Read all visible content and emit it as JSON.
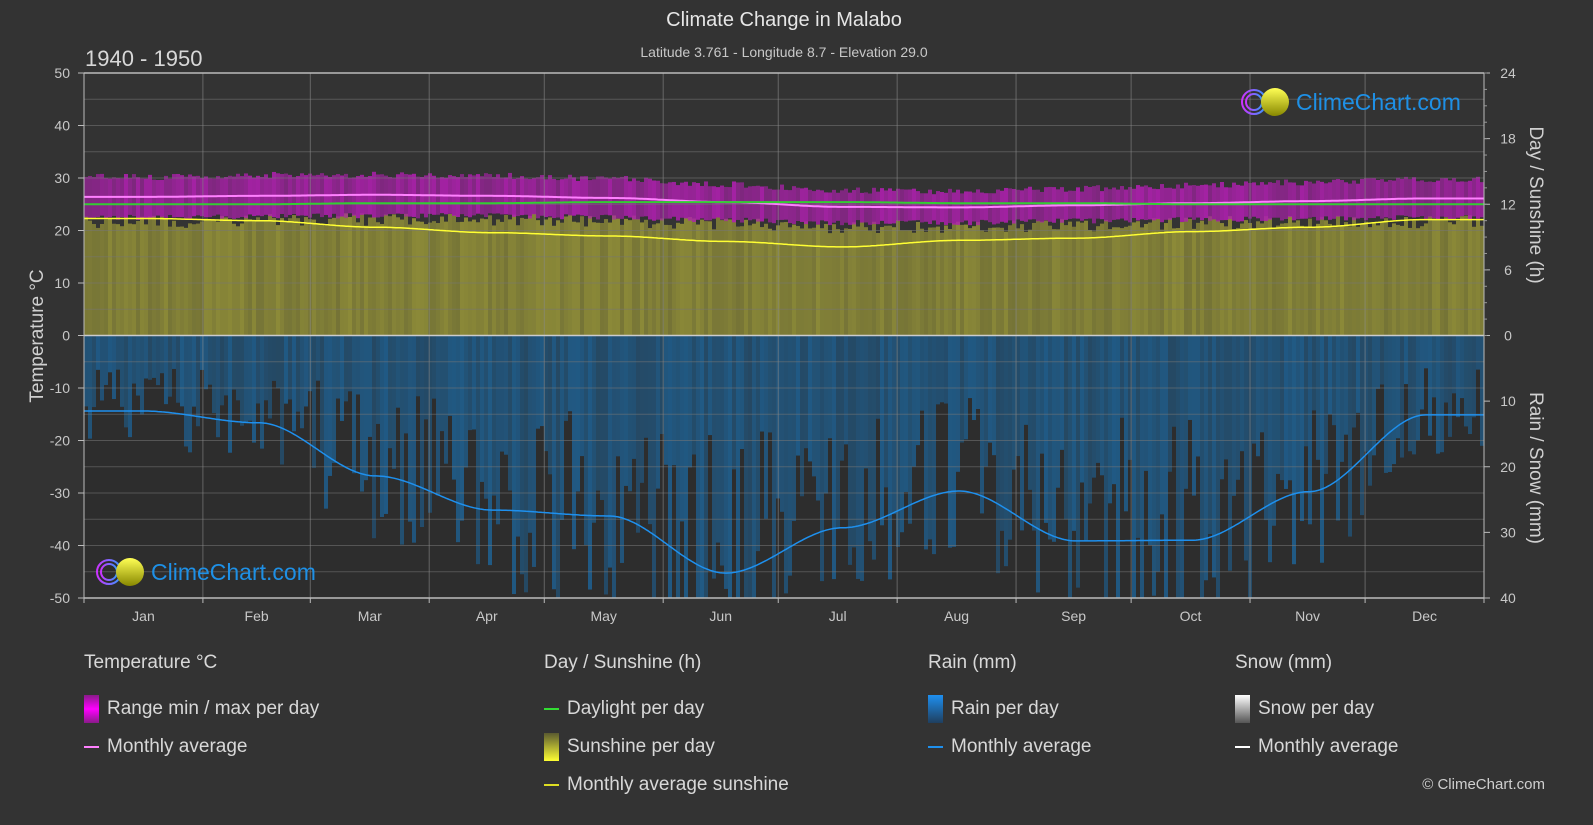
{
  "header": {
    "title": "Climate Change in Malabo",
    "subtitle": "Latitude 3.761 - Longitude 8.7 - Elevation 29.0",
    "period": "1940 - 1950"
  },
  "watermark": {
    "text": "ClimeChart.com"
  },
  "copyright": "© ClimeChart.com",
  "colors": {
    "background": "#333333",
    "temp_range": "#b020b0",
    "temp_avg": "#ff80ff",
    "daylight": "#33cc33",
    "sunshine_fill": "#8c8a38",
    "sunshine_avg": "#ffff33",
    "rain_fill": "#1f5f8f",
    "rain_avg": "#1e90ee",
    "snow_avg": "#ffffff",
    "grid": "#5a5a5a",
    "logo_text": "#1e90e6"
  },
  "legend": {
    "temperature": {
      "title": "Temperature °C",
      "items": [
        "Range min / max per day",
        "Monthly average"
      ]
    },
    "sunshine": {
      "title": "Day / Sunshine (h)",
      "items": [
        "Daylight per day",
        "Sunshine per day",
        "Monthly average sunshine"
      ]
    },
    "rain": {
      "title": "Rain (mm)",
      "items": [
        "Rain per day",
        "Monthly average"
      ]
    },
    "snow": {
      "title": "Snow (mm)",
      "items": [
        "Snow per day",
        "Monthly average"
      ]
    }
  },
  "chart_data": {
    "type": "area",
    "title": "Climate Change in Malabo",
    "subtitle": "Latitude 3.761 - Longitude 8.7 - Elevation 29.0",
    "categories": [
      "Jan",
      "Feb",
      "Mar",
      "Apr",
      "May",
      "Jun",
      "Jul",
      "Aug",
      "Sep",
      "Oct",
      "Nov",
      "Dec"
    ],
    "left_axis": {
      "label": "Temperature °C",
      "range": [
        -50,
        50
      ],
      "ticks": [
        50,
        40,
        30,
        20,
        10,
        0,
        -10,
        -20,
        -30,
        -40,
        -50
      ]
    },
    "right_axis_top": {
      "label": "Day / Sunshine (h)",
      "range": [
        0,
        24
      ],
      "ticks": [
        24,
        18,
        12,
        6,
        0
      ]
    },
    "right_axis_bottom": {
      "label": "Rain / Snow (mm)",
      "range": [
        0,
        40
      ],
      "ticks": [
        0,
        10,
        20,
        30,
        40
      ]
    },
    "grid": true,
    "legend_position": "bottom",
    "series": [
      {
        "name": "Temperature monthly average",
        "axis": "temperature",
        "values": [
          26.4,
          26.6,
          26.8,
          26.6,
          26.2,
          25.4,
          24.5,
          24.4,
          24.8,
          25.2,
          25.6,
          26.1
        ]
      },
      {
        "name": "Temperature range min",
        "axis": "temperature",
        "values": [
          23.0,
          23.2,
          23.3,
          23.3,
          23.0,
          22.5,
          22.0,
          22.0,
          22.3,
          22.6,
          22.8,
          23.0
        ]
      },
      {
        "name": "Temperature range max",
        "axis": "temperature",
        "values": [
          29.6,
          30.0,
          30.0,
          29.8,
          29.3,
          28.2,
          27.0,
          26.8,
          27.4,
          28.0,
          28.6,
          29.2
        ]
      },
      {
        "name": "Daylight per day",
        "axis": "sunshine",
        "values": [
          12.0,
          12.0,
          12.1,
          12.1,
          12.2,
          12.2,
          12.2,
          12.1,
          12.1,
          12.0,
          12.0,
          12.0
        ]
      },
      {
        "name": "Sunshine per day (max band)",
        "axis": "sunshine",
        "values": [
          11.0,
          11.1,
          11.2,
          11.2,
          11.0,
          10.8,
          10.5,
          10.6,
          10.7,
          10.9,
          11.0,
          11.0
        ]
      },
      {
        "name": "Monthly average sunshine",
        "axis": "sunshine",
        "values": [
          10.7,
          10.5,
          9.9,
          9.4,
          9.1,
          8.6,
          8.1,
          8.7,
          8.9,
          9.5,
          9.9,
          10.6
        ]
      },
      {
        "name": "Rain monthly average",
        "axis": "rain",
        "values": [
          11.5,
          13.3,
          21.4,
          26.6,
          27.5,
          36.2,
          29.3,
          23.7,
          31.3,
          31.2,
          23.8,
          12.1
        ]
      },
      {
        "name": "Snow monthly average",
        "axis": "rain",
        "values": [
          0,
          0,
          0,
          0,
          0,
          0,
          0,
          0,
          0,
          0,
          0,
          0
        ]
      }
    ]
  }
}
